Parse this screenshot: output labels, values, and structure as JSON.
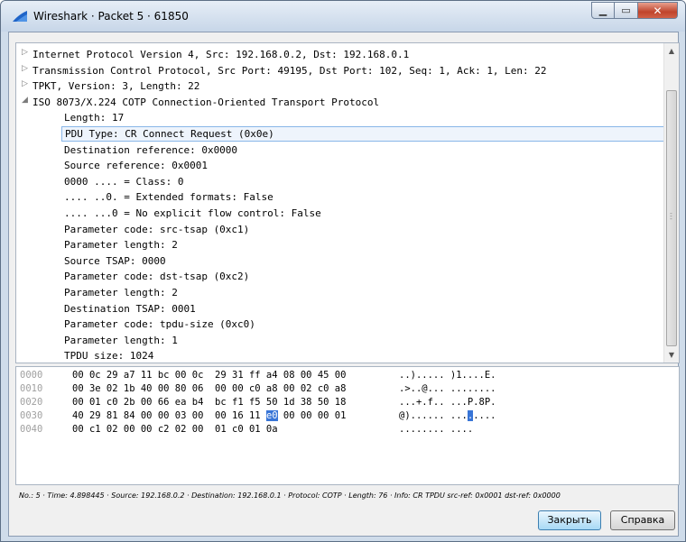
{
  "window": {
    "title": "Wireshark · Packet 5 · 61850",
    "minimize_icon": "minimize-icon",
    "maximize_icon": "maximize-icon",
    "close_icon": "close-icon"
  },
  "tree": {
    "rows": [
      {
        "text": "Internet Protocol Version 4, Src: 192.168.0.2, Dst: 192.168.0.1",
        "arrow": "▷"
      },
      {
        "text": "Transmission Control Protocol, Src Port: 49195, Dst Port: 102, Seq: 1, Ack: 1, Len: 22",
        "arrow": "▷"
      },
      {
        "text": "TPKT, Version: 3, Length: 22",
        "arrow": "▷"
      },
      {
        "text": "ISO 8073/X.224 COTP Connection-Oriented Transport Protocol",
        "arrow": "◢"
      },
      {
        "text": "Length: 17"
      },
      {
        "text": "PDU Type: CR Connect Request (0x0e)",
        "selected": true
      },
      {
        "text": "Destination reference: 0x0000"
      },
      {
        "text": "Source reference: 0x0001"
      },
      {
        "text": "0000 .... = Class: 0"
      },
      {
        "text": ".... ..0. = Extended formats: False"
      },
      {
        "text": ".... ...0 = No explicit flow control: False"
      },
      {
        "text": "Parameter code: src-tsap (0xc1)"
      },
      {
        "text": "Parameter length: 2"
      },
      {
        "text": "Source TSAP: 0000"
      },
      {
        "text": "Parameter code: dst-tsap (0xc2)"
      },
      {
        "text": "Parameter length: 2"
      },
      {
        "text": "Destination TSAP: 0001"
      },
      {
        "text": "Parameter code: tpdu-size (0xc0)"
      },
      {
        "text": "Parameter length: 1"
      },
      {
        "text": "TPDU size: 1024"
      }
    ]
  },
  "hex": {
    "rows": [
      {
        "offset": "0000",
        "b1": "00 0c 29 a7 11 bc 00 0c  29 31 ff a4 08 00 45 00",
        "b2": "",
        "b3": "",
        "a1": "..)..... )1....E.",
        "a2": "",
        "a3": ""
      },
      {
        "offset": "0010",
        "b1": "00 3e 02 1b 40 00 80 06  00 00 c0 a8 00 02 c0 a8",
        "b2": "",
        "b3": "",
        "a1": ".>..@... ........",
        "a2": "",
        "a3": ""
      },
      {
        "offset": "0020",
        "b1": "00 01 c0 2b 00 66 ea b4  bc f1 f5 50 1d 38 50 18",
        "b2": "",
        "b3": "",
        "a1": "...+.f.. ...P.8P.",
        "a2": "",
        "a3": ""
      },
      {
        "offset": "0030",
        "b1": "40 29 81 84 00 00 03 00  00 16 11 ",
        "b2": "e0",
        "b3": " 00 00 00 01",
        "a1": "@)...... ...",
        "a2": ".",
        "a3": "...."
      },
      {
        "offset": "0040",
        "b1": "00 c1 02 00 00 c2 02 00  01 c0 01 0a",
        "b2": "",
        "b3": "",
        "a1": "........ ....",
        "a2": "",
        "a3": ""
      }
    ]
  },
  "status": "No.: 5 · Time: 4.898445 · Source: 192.168.0.2 · Destination: 192.168.0.1 · Protocol: COTP · Length: 76 · Info: CR TPDU src-ref: 0x0001 dst-ref: 0x0000",
  "buttons": {
    "close_label": "Закрыть",
    "help_label": "Справка"
  },
  "scrollbar": {
    "up_icon": "scroll-up-arrow-icon",
    "down_icon": "scroll-down-arrow-icon"
  },
  "colors": {
    "selection_border": "#89b6e8",
    "hex_highlight": "#3875d7"
  }
}
